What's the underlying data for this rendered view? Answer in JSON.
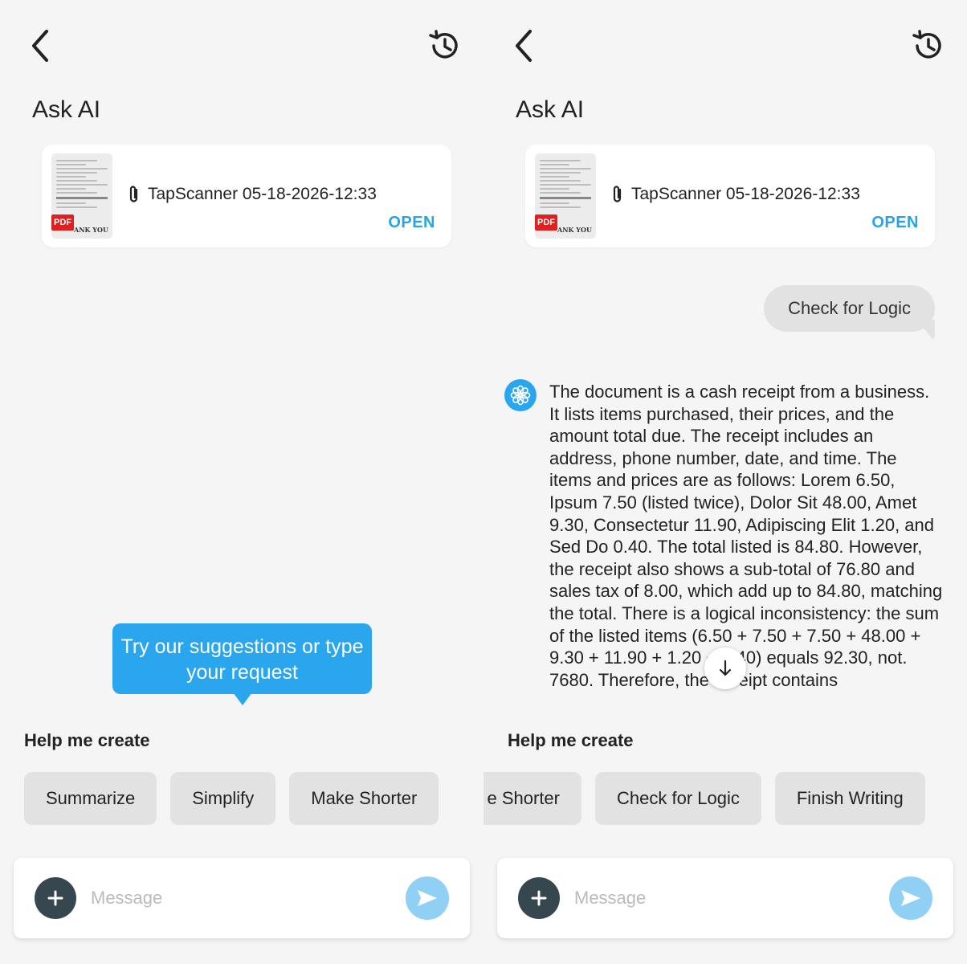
{
  "left": {
    "title": "Ask AI",
    "attachment": {
      "name": "TapScanner 05-18-2026-12:33",
      "open_label": "OPEN",
      "pdf_badge": "PDF",
      "thumb_footer": "ANK YOU"
    },
    "tooltip": "Try our suggestions or type your request",
    "section_label": "Help me create",
    "chips": [
      "Summarize",
      "Simplify",
      "Make Shorter"
    ],
    "input": {
      "placeholder": "Message",
      "value": ""
    }
  },
  "right": {
    "title": "Ask AI",
    "attachment": {
      "name": "TapScanner 05-18-2026-12:33",
      "open_label": "OPEN",
      "pdf_badge": "PDF",
      "thumb_footer": "ANK YOU"
    },
    "user_message": "Check for Logic",
    "ai_response": "The document is a cash receipt from a business. It lists items purchased, their prices, and the amount total due. The receipt includes an address, phone number, date, and time. The items and prices are as follows: Lorem 6.50, Ipsum 7.50 (listed twice), Dolor Sit 48.00, Amet 9.30, Consectetur 11.90, Adipiscing Elit 1.20, and Sed Do 0.40. The total listed is 84.80. However, the receipt also shows a sub-total of 76.80 and sales tax of 8.00, which add up to 84.80, matching the total. There is a logical inconsistency: the sum of the listed items (6.50 + 7.50 + 7.50 + 48.00 + 9.30 + 11.90 + 1.20 + 0.40) equals 92.30, not. 7680. Therefore, the receipt contains",
    "section_label": "Help me create",
    "chips": [
      "e Shorter",
      "Check for Logic",
      "Finish Writing"
    ],
    "input": {
      "placeholder": "Message",
      "value": ""
    }
  },
  "icons": {
    "back": "chevron-left-icon",
    "history": "history-icon",
    "attachment": "paperclip-icon",
    "plus": "plus-icon",
    "send": "send-icon",
    "scroll_down": "arrow-down-icon",
    "ai_avatar": "ai-logo-icon"
  },
  "colors": {
    "accent": "#2aa6ee",
    "open_link": "#27a4e6",
    "chip_bg": "#e2e2e2",
    "plus_bg": "#37474f",
    "send_bg": "#8fd0f4",
    "pdf_red": "#e02020"
  }
}
